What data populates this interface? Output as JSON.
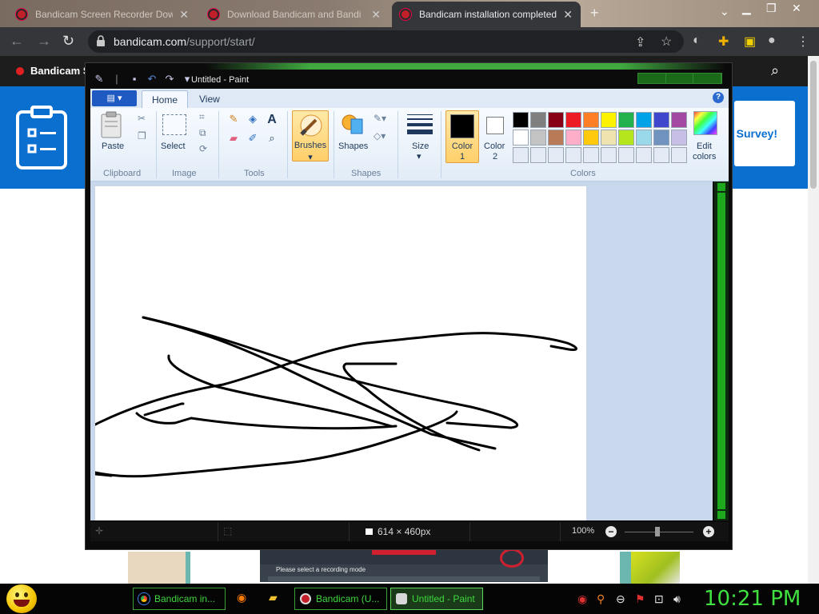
{
  "browser": {
    "tabs": [
      {
        "label": "Bandicam Screen Recorder Dow"
      },
      {
        "label": "Download Bandicam and Bandi"
      },
      {
        "label": "Bandicam installation completed"
      }
    ],
    "new_tab_label": "+",
    "url_domain": "bandicam.com",
    "url_path": "/support/start/"
  },
  "page": {
    "brand": "Bandicam S",
    "survey_label": "Survey!",
    "recording_hint": "Please select a recording mode"
  },
  "paint": {
    "title": "Untitled - Paint",
    "tabs": {
      "file": "▤ ▾",
      "home": "Home",
      "view": "View"
    },
    "groups": {
      "clipboard": "Clipboard",
      "image": "Image",
      "tools": "Tools",
      "shapes": "Shapes",
      "colors": "Colors"
    },
    "buttons": {
      "paste": "Paste",
      "select": "Select",
      "brushes": "Brushes",
      "shapes": "Shapes",
      "size": "Size",
      "color1": "Color",
      "color1_num": "1",
      "color2": "Color",
      "color2_num": "2",
      "edit_colors_line1": "Edit",
      "edit_colors_line2": "colors",
      "text_tool": "A"
    },
    "colors": {
      "color1": "#000000",
      "color2": "#ffffff",
      "palette": [
        "#000000",
        "#7f7f7f",
        "#880015",
        "#ed1c24",
        "#ff7f27",
        "#fff200",
        "#22b14c",
        "#00a2e8",
        "#3f48cc",
        "#a349a4",
        "#ffffff",
        "#c3c3c3",
        "#b97a57",
        "#ffaec9",
        "#ffc90e",
        "#efe4b0",
        "#b5e61d",
        "#99d9ea",
        "#7092be",
        "#c8bfe7",
        "#e4ebf5",
        "#e4ebf5",
        "#e4ebf5",
        "#e4ebf5",
        "#e4ebf5",
        "#e4ebf5",
        "#e4ebf5",
        "#e4ebf5",
        "#e4ebf5",
        "#e4ebf5"
      ]
    },
    "status": {
      "dimensions": "614 × 460px",
      "zoom": "100%",
      "zoom_out": "−",
      "zoom_in": "+"
    }
  },
  "taskbar": {
    "tasks": [
      {
        "label": "Bandicam in..."
      },
      {
        "label": "Bandicam (U..."
      },
      {
        "label": "Untitled - Paint"
      }
    ],
    "clock": "10:21 PM"
  }
}
